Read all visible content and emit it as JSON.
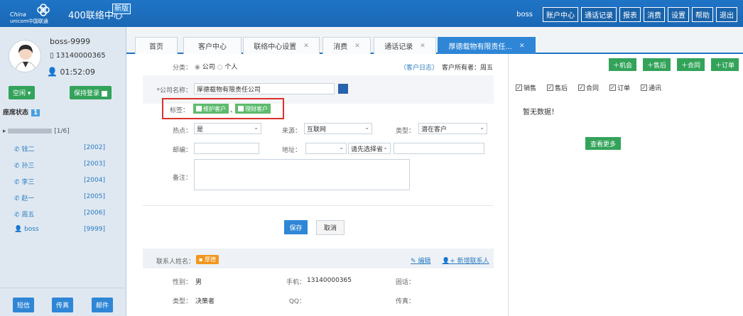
{
  "app": {
    "logo_text": "China unicom中国联通",
    "title": "400联络中心",
    "new_badge": "新版",
    "top_user": "boss",
    "top_menu": [
      "账户中心",
      "通话记录",
      "报表",
      "消费",
      "设置",
      "帮助",
      "退出"
    ]
  },
  "sidebar": {
    "user_name": "boss-9999",
    "phone": "13140000365",
    "timer": "01:52:09",
    "status_label": "空闲",
    "keep_login_label": "保持登录",
    "seat_status_label": "座席状态",
    "seat_status_count": "1",
    "group_label": "[1/6]",
    "agents": [
      {
        "name": "钱二",
        "ext": "[2002]"
      },
      {
        "name": "孙三",
        "ext": "[2003]"
      },
      {
        "name": "李三",
        "ext": "[2004]"
      },
      {
        "name": "赵一",
        "ext": "[2005]"
      },
      {
        "name": "周五",
        "ext": "[2006]"
      },
      {
        "name": "boss",
        "ext": "[9999]"
      }
    ],
    "footer_buttons": [
      "短信",
      "传真",
      "邮件"
    ]
  },
  "tabs": [
    {
      "label": "首页",
      "closable": false
    },
    {
      "label": "客户中心",
      "closable": false
    },
    {
      "label": "联络中心设置",
      "closable": true
    },
    {
      "label": "消费",
      "closable": true
    },
    {
      "label": "通话记录",
      "closable": true
    },
    {
      "label": "厚德载物有限责任...",
      "closable": true,
      "active": true
    }
  ],
  "form": {
    "category_label": "分类：",
    "option_company": "公司",
    "option_person": "个人",
    "customer_log": "（客户日志）",
    "owner": "客户所有者：周五",
    "company_label": "*公司名称：",
    "company_value": "厚德载物有限责任公司",
    "tags_label": "标签：",
    "tag1": "维护客户",
    "tag_sep": "、",
    "tag2": "理财客户",
    "hot_label": "热点：",
    "hot_value": "是",
    "source_label": "来源：",
    "source_value": "互联网",
    "type_label": "类型：",
    "type_value": "潜在客户",
    "zip_label": "邮编：",
    "address_label": "地址：",
    "address_select_value": "",
    "city_placeholder": "请先选择省",
    "notes_label": "备注：",
    "save_label": "保存",
    "cancel_label": "取消"
  },
  "contact": {
    "name_label": "联系人姓名：",
    "name_value": "厚德",
    "edit_label": "编辑",
    "new_contact_label": "新增联系人",
    "gender_label": "性别：",
    "gender_value": "男",
    "mobile_label": "手机：",
    "mobile_value": "13140000365",
    "landline_label": "固话：",
    "role_label": "类型：",
    "role_value": "决策者",
    "qq_label": "QQ：",
    "fax_label": "传真："
  },
  "right_panel": {
    "actions": [
      "机会",
      "售后",
      "合同",
      "订单"
    ],
    "filters": [
      "销售",
      "售后",
      "合同",
      "订单",
      "通讯"
    ],
    "empty_text": "暂无数据！",
    "more_label": "查看更多"
  }
}
